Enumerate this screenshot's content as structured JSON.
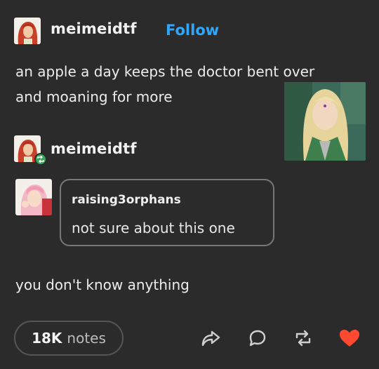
{
  "post": {
    "author": "meimeidtf",
    "follow_label": "Follow",
    "text": "an apple a day keeps the doctor bent over and moaning for more"
  },
  "reblog": {
    "author": "meimeidtf",
    "quoted_reply": {
      "author": "raising3orphans",
      "text": "not sure about this one"
    },
    "reply_text": "you don't know anything"
  },
  "footer": {
    "notes_count": "18K",
    "notes_label": "notes"
  },
  "colors": {
    "background": "#2b2b2b",
    "follow": "#2ea8ff",
    "reblog_badge": "#3aa55c",
    "like": "#ff4930"
  },
  "icons": [
    "share-icon",
    "comment-icon",
    "reblog-icon",
    "heart-icon"
  ]
}
